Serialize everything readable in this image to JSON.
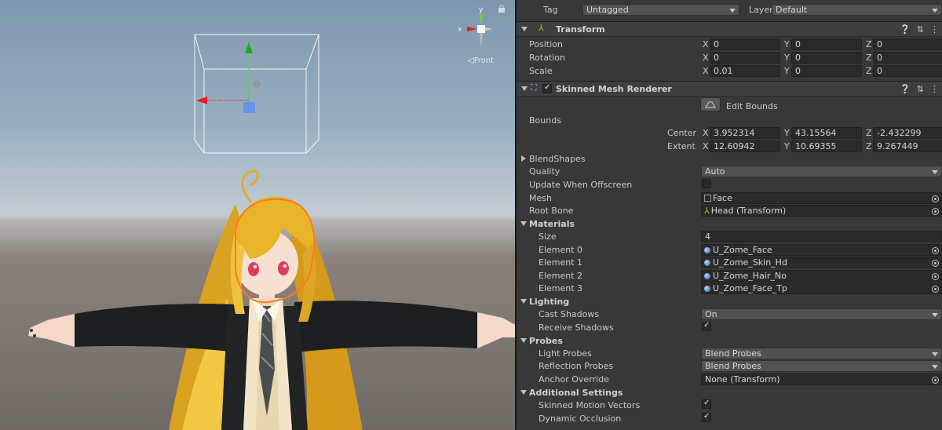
{
  "scene": {
    "gizmo_axes": {
      "x": "x",
      "y": "y"
    },
    "view_label": "Front"
  },
  "inspector": {
    "tag_label": "Tag",
    "tag_value": "Untagged",
    "layer_label": "Layer",
    "layer_value": "Default",
    "transform": {
      "title": "Transform",
      "position_label": "Position",
      "rotation_label": "Rotation",
      "scale_label": "Scale",
      "position": {
        "x": "0",
        "y": "0",
        "z": "0"
      },
      "rotation": {
        "x": "0",
        "y": "0",
        "z": "0"
      },
      "scale": {
        "x": "0.01",
        "y": "0",
        "z": "0"
      }
    },
    "smr": {
      "title": "Skinned Mesh Renderer",
      "edit_bounds_label": "Edit Bounds",
      "bounds_label": "Bounds",
      "center_label": "Center",
      "extent_label": "Extent",
      "center": {
        "x": "3.952314",
        "y": "43.15564",
        "z": "-2.432299"
      },
      "extent": {
        "x": "12.60942",
        "y": "10.69355",
        "z": "9.267449"
      },
      "blendshapes_label": "BlendShapes",
      "quality_label": "Quality",
      "quality_value": "Auto",
      "update_offscreen_label": "Update When Offscreen",
      "mesh_label": "Mesh",
      "mesh_value": "Face",
      "root_bone_label": "Root Bone",
      "root_bone_value": "Head (Transform)",
      "materials_label": "Materials",
      "size_label": "Size",
      "size_value": "4",
      "elements": [
        {
          "label": "Element 0",
          "value": "U_Zome_Face"
        },
        {
          "label": "Element 1",
          "value": "U_Zome_Skin_Hd"
        },
        {
          "label": "Element 2",
          "value": "U_Zome_Hair_No"
        },
        {
          "label": "Element 3",
          "value": "U_Zome_Face_Tp"
        }
      ],
      "lighting_label": "Lighting",
      "cast_shadows_label": "Cast Shadows",
      "cast_shadows_value": "On",
      "receive_shadows_label": "Receive Shadows",
      "probes_label": "Probes",
      "light_probes_label": "Light Probes",
      "light_probes_value": "Blend Probes",
      "reflection_probes_label": "Reflection Probes",
      "reflection_probes_value": "Blend Probes",
      "anchor_override_label": "Anchor Override",
      "anchor_override_value": "None (Transform)",
      "additional_label": "Additional Settings",
      "motion_vectors_label": "Skinned Motion Vectors",
      "dynamic_occlusion_label": "Dynamic Occlusion"
    }
  },
  "colors": {
    "inspector_bg": "#383838",
    "field_bg": "#2a2a2a",
    "selection_outline": "#ff7a1a"
  }
}
